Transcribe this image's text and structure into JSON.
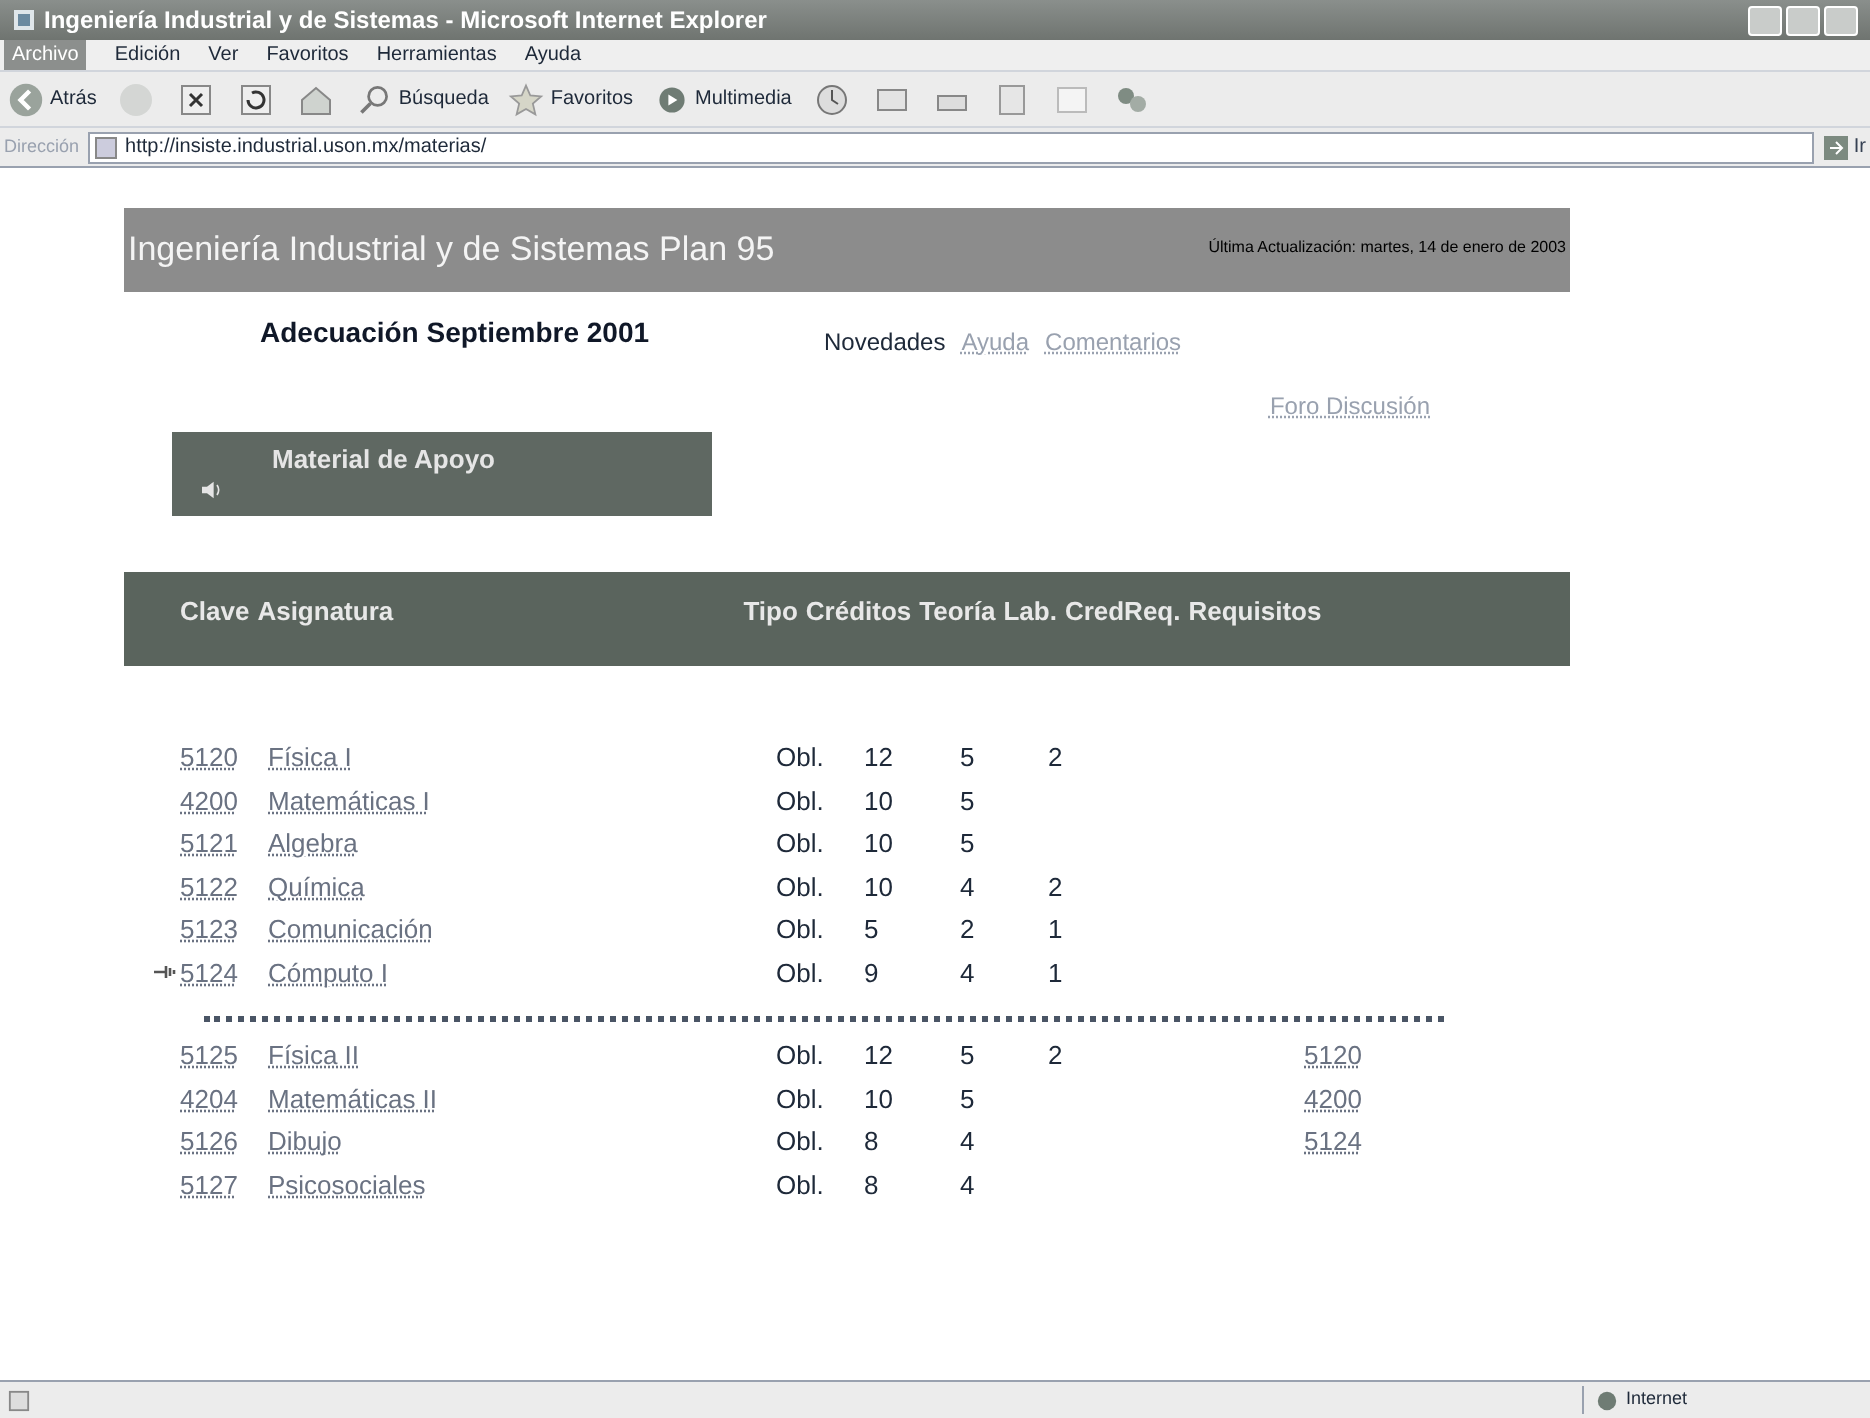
{
  "window": {
    "title": "Ingeniería Industrial y de Sistemas - Microsoft Internet Explorer"
  },
  "menu": [
    {
      "label": "Archivo",
      "selected": true
    },
    {
      "label": "Edición",
      "selected": false
    },
    {
      "label": "Ver",
      "selected": false
    },
    {
      "label": "Favoritos",
      "selected": false
    },
    {
      "label": "Herramientas",
      "selected": false
    },
    {
      "label": "Ayuda",
      "selected": false
    }
  ],
  "toolbar": {
    "back": "Atrás",
    "search": "Búsqueda",
    "favorites": "Favoritos",
    "media": "Multimedia"
  },
  "address": {
    "label": "Dirección",
    "value": "http://insiste.industrial.uson.mx/materias/",
    "go": "Ir"
  },
  "page": {
    "banner_title": "Ingeniería Industrial y de Sistemas Plan 95",
    "updated": "Última Actualización: martes, 14 de enero de 2003",
    "heading": "Adecuación Septiembre 2001",
    "nav": [
      {
        "label": "Novedades",
        "link": false
      },
      {
        "label": "Ayuda",
        "link": true
      },
      {
        "label": "Comentarios",
        "link": true
      }
    ],
    "forum": "Foro Discusión",
    "support": "Material de Apoyo",
    "table": {
      "columns": [
        "Clave",
        "Asignatura",
        "Tipo",
        "Créditos",
        "Teoría",
        "Lab.",
        "CredReq.",
        "Requisitos"
      ],
      "rows": [
        {
          "kind": "course",
          "pointer": false,
          "code": "5120",
          "name": "Física I",
          "type": "Obl.",
          "credits": "12",
          "theory": "5",
          "lab": "2",
          "req": ""
        },
        {
          "kind": "course",
          "pointer": false,
          "code": "4200",
          "name": "Matemáticas I",
          "type": "Obl.",
          "credits": "10",
          "theory": "5",
          "lab": "",
          "req": ""
        },
        {
          "kind": "course",
          "pointer": false,
          "code": "5121",
          "name": "Algebra",
          "type": "Obl.",
          "credits": "10",
          "theory": "5",
          "lab": "",
          "req": ""
        },
        {
          "kind": "course",
          "pointer": false,
          "code": "5122",
          "name": "Química",
          "type": "Obl.",
          "credits": "10",
          "theory": "4",
          "lab": "2",
          "req": ""
        },
        {
          "kind": "course",
          "pointer": false,
          "code": "5123",
          "name": "Comunicación",
          "type": "Obl.",
          "credits": "5",
          "theory": "2",
          "lab": "1",
          "req": ""
        },
        {
          "kind": "course",
          "pointer": true,
          "code": "5124",
          "name": "Cómputo I",
          "type": "Obl.",
          "credits": "9",
          "theory": "4",
          "lab": "1",
          "req": ""
        },
        {
          "kind": "separator"
        },
        {
          "kind": "course",
          "pointer": false,
          "code": "5125",
          "name": "Física II",
          "type": "Obl.",
          "credits": "12",
          "theory": "5",
          "lab": "2",
          "req": "5120"
        },
        {
          "kind": "course",
          "pointer": false,
          "code": "4204",
          "name": "Matemáticas II",
          "type": "Obl.",
          "credits": "10",
          "theory": "5",
          "lab": "",
          "req": "4200"
        },
        {
          "kind": "course",
          "pointer": false,
          "code": "5126",
          "name": "Dibujo",
          "type": "Obl.",
          "credits": "8",
          "theory": "4",
          "lab": "",
          "req": "5124"
        },
        {
          "kind": "course",
          "pointer": false,
          "code": "5127",
          "name": "Psicosociales",
          "type": "Obl.",
          "credits": "8",
          "theory": "4",
          "lab": "",
          "req": ""
        }
      ]
    }
  },
  "status_bar": {
    "zone": "Internet"
  }
}
